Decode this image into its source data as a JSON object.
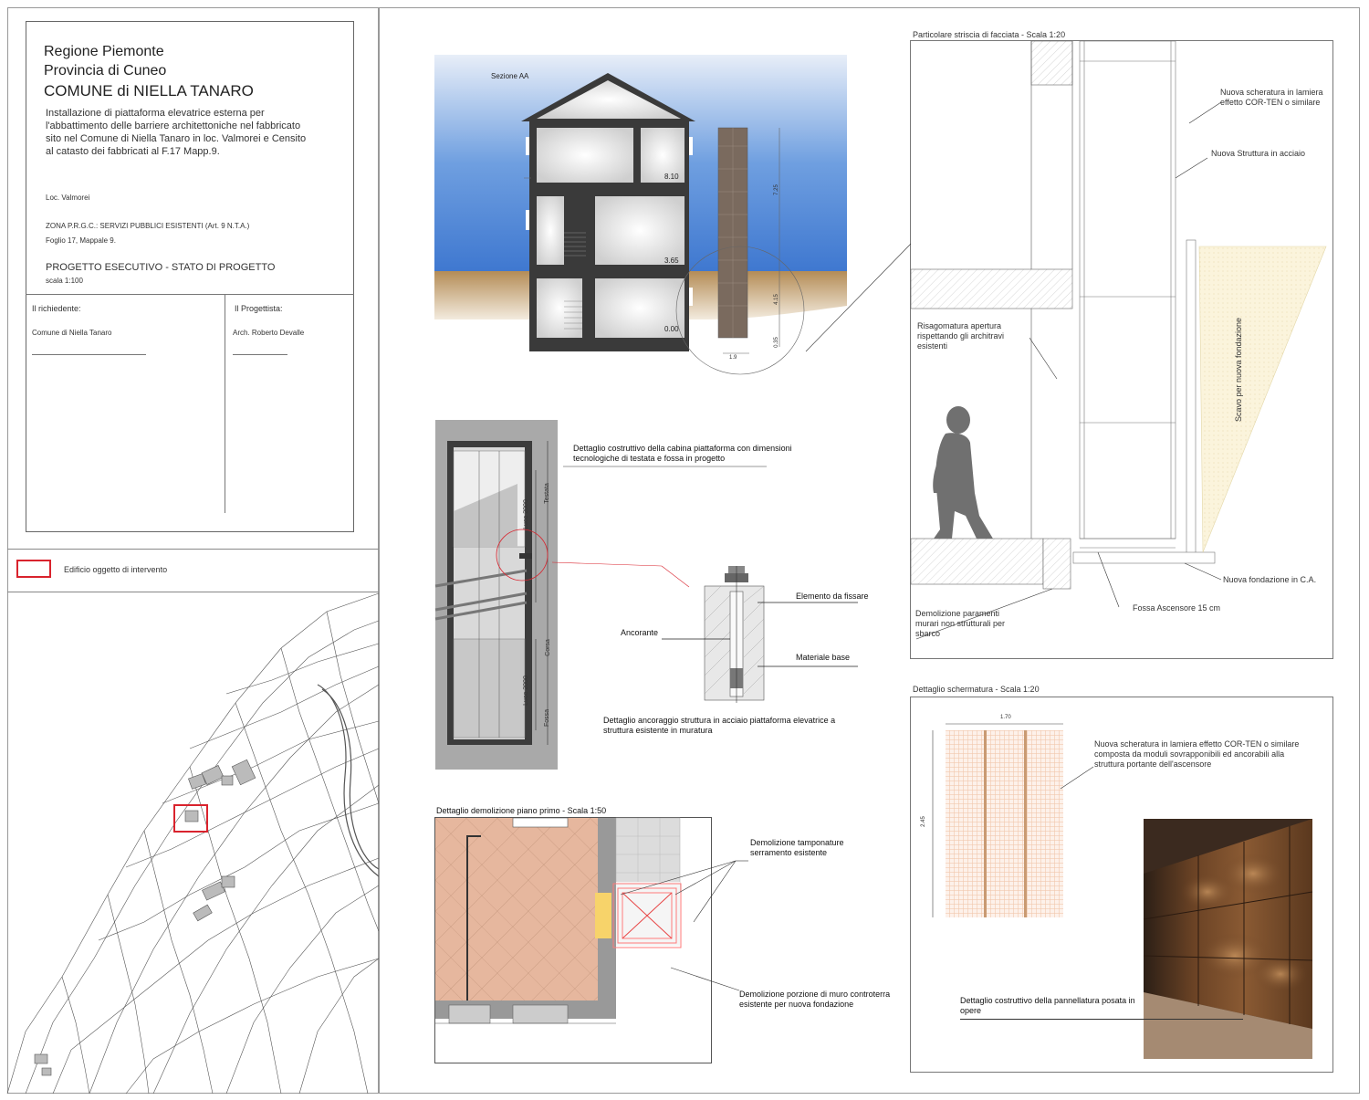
{
  "title_block": {
    "region": "Regione Piemonte",
    "province": "Provincia di Cuneo",
    "municipality": "COMUNE di NIELLA TANARO",
    "description": "Installazione di piattaforma elevatrice esterna per l'abbattimento delle barriere architettoniche nel fabbricato sito nel Comune di Niella Tanaro in loc. Valmorei e Censito al catasto dei fabbricati al F.17 Mapp.9.",
    "locality": "Loc. Valmorei",
    "zone": "ZONA P.R.G.C.: SERVIZI PUBBLICI ESISTENTI (Art. 9 N.T.A.)",
    "sheet": "Foglio 17,  Mappale 9.",
    "phase": "PROGETTO ESECUTIVO - STATO DI PROGETTO",
    "scale": "scala 1:100",
    "applicant_label": "Il richiedente:",
    "applicant_name": "Comune di Niella Tanaro",
    "designer_label": "Il Progettista:",
    "designer_name": "Arch. Roberto Devalle"
  },
  "cadastral_map": {
    "legend": "Edificio oggetto di intervento",
    "highlight_color": "#d9232d"
  },
  "section_aa": {
    "title": "Sezione AA",
    "levels": [
      "8.10",
      "3.65",
      "0.00"
    ],
    "dimensions": [
      "7.25",
      "4.15",
      "0.35",
      "1.9"
    ]
  },
  "cabin_detail": {
    "title": "Dettaglio costruttivo della cabina piattaforma con dimensioni tecnologiche di testata e fossa in progetto",
    "dim_labels": [
      "Testata",
      "Luce 2000",
      "Corsa",
      "Luce 2000",
      "Fossa"
    ]
  },
  "anchor_detail": {
    "labels": [
      "Elemento da fissare",
      "Ancorante",
      "Materiale base"
    ],
    "caption": "Dettaglio ancoraggio struttura in acciaio piattaforma elevatrice a struttura esistente in muratura"
  },
  "demolition_detail": {
    "title": "Dettaglio demolizione piano primo - Scala 1:50",
    "label_1": "Demolizione tamponature serramento esistente",
    "label_2": "Demolizione porzione di muro controterra esistente per nuova fondazione"
  },
  "facade_strip": {
    "title": "Particolare striscia di facciata - Scala 1:20",
    "labels": [
      "Nuova scheratura in lamiera effetto COR-TEN o similare",
      "Nuova Struttura in acciaio",
      "Risagomatura apertura rispettando gli architravi esistenti",
      "Scavo per nuova fondazione",
      "Nuova fondazione in C.A.",
      "Fossa Ascensore 15 cm",
      "Demolizione paramenti murari non strutturali per sbarco"
    ]
  },
  "screening_detail": {
    "title": "Dettaglio schermatura - Scala 1:20",
    "dim_width": "1.70",
    "dim_height": "2.45",
    "label": "Nuova scheratura in lamiera effetto COR-TEN o similare composta da moduli sovrapponibili ed ancorabili alla struttura portante dell'ascensore",
    "photo_caption": "Dettaglio costruttivo della pannellatura posata in opere"
  },
  "colors": {
    "sky": "#5b8fd6",
    "ground": "#c8a46e",
    "corten": "#6b4325",
    "wall_dark": "#3a3a3a",
    "brick": "#e8b9a0"
  }
}
